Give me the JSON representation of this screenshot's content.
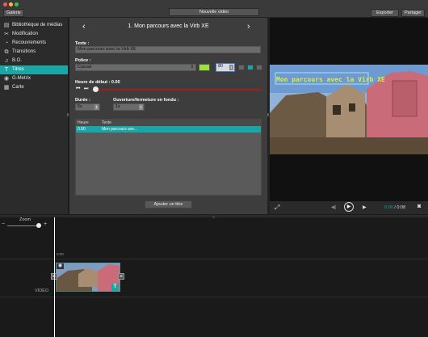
{
  "window": {
    "gallery_btn": "Galerie",
    "new_video_btn": "Nouvelle vidéo",
    "export_btn": "Exporter",
    "share_btn": "Partager"
  },
  "sidebar": {
    "items": [
      {
        "label": "Bibliothèque de médias",
        "icon": "film-icon"
      },
      {
        "label": "Modification",
        "icon": "scissors-icon"
      },
      {
        "label": "Recouvrements",
        "icon": "overlay-icon"
      },
      {
        "label": "Transitions",
        "icon": "transition-icon"
      },
      {
        "label": "B.O.",
        "icon": "music-note-icon"
      },
      {
        "label": "Titres",
        "icon": "text-icon"
      },
      {
        "label": "G-Metrix",
        "icon": "eye-icon"
      },
      {
        "label": "Carte",
        "icon": "map-icon"
      }
    ],
    "active_index": 5
  },
  "editor": {
    "title": "1. Mon parcours avec la Virb XE",
    "prev": "‹",
    "next": "›",
    "text_label": "Texte :",
    "text_value": "Mon parcours avec la Virb XE",
    "font_label": "Police :",
    "font_value": "Casual",
    "font_size": "80",
    "start_label": "Heure de début : 0.00",
    "duration_label": "Durée :",
    "duration_value": "5s",
    "fade_label": "Ouverture/fermeture en fondu :",
    "fade_value": "1s",
    "table_headers": [
      "Heure",
      "Texte"
    ],
    "table_rows": [
      {
        "time": "0.00",
        "text": "Mon parcours ave..."
      }
    ],
    "add_title_btn": "Ajouter un titre",
    "accent_color": "#1aa6a6",
    "text_color_swatch": "#9be33a"
  },
  "preview": {
    "overlay_text": "Mon parcours avec la Virb XE",
    "time_current": "0:00",
    "time_separator": " / ",
    "time_total": "0:08"
  },
  "timeline": {
    "zoom_label": "Zoom",
    "zoom_minus": "−",
    "zoom_plus": "+",
    "tick_label": "0:00",
    "track_label": "VIDÉO",
    "title_badge": "T"
  }
}
